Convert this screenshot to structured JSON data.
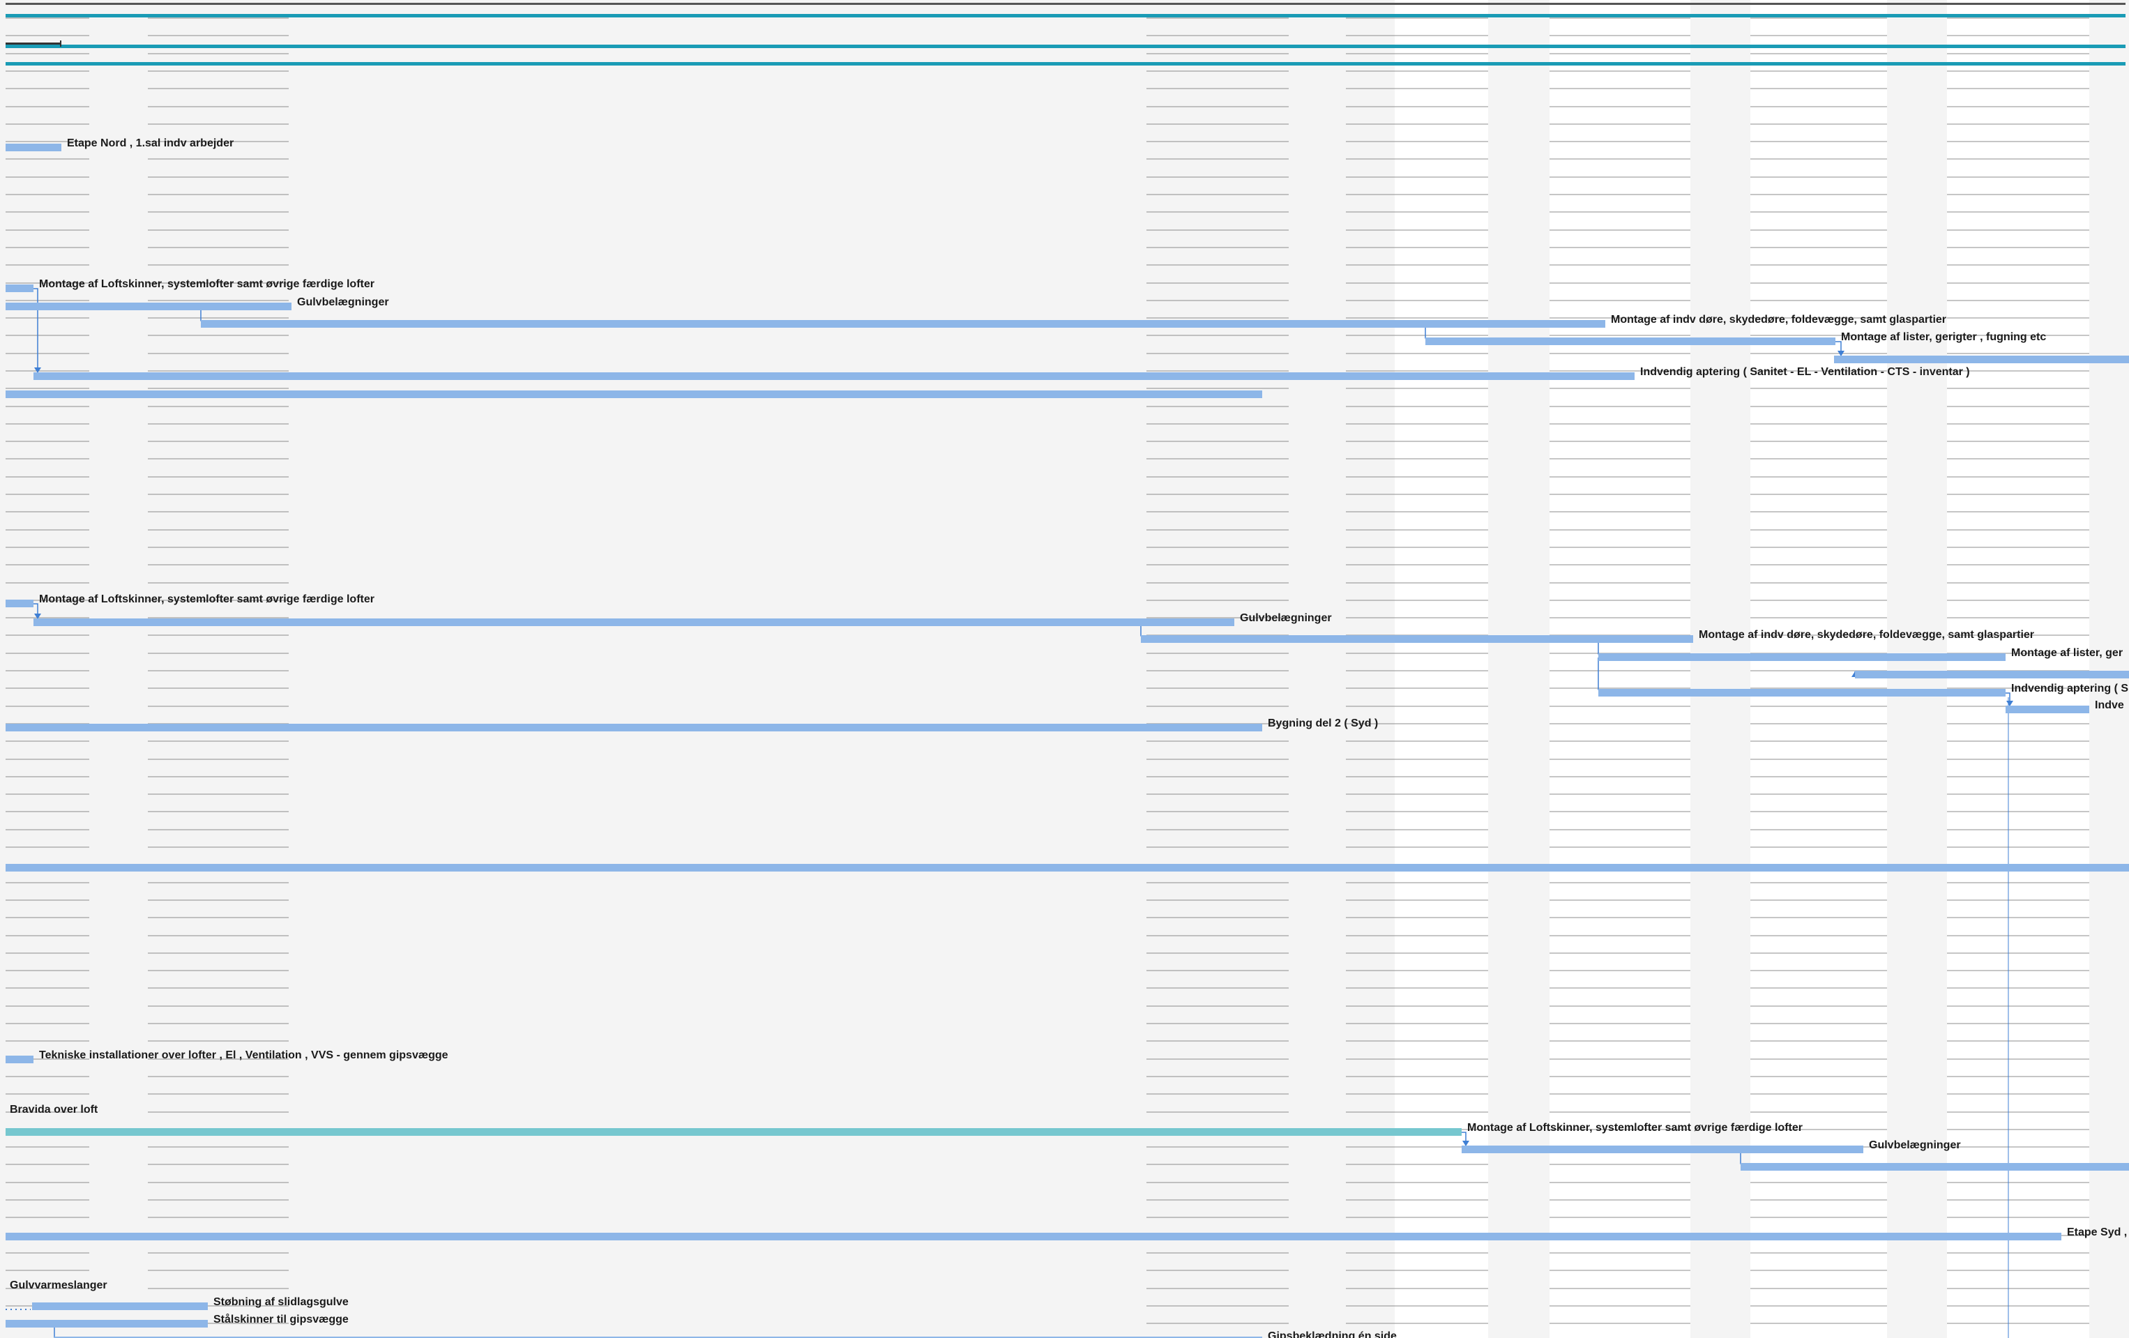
{
  "view": "gantt-chart",
  "colors": {
    "task_bar": "#8DB6E8",
    "critical_bar": "#76C7CF",
    "summary_line": "#1A9BB5",
    "link": "#3F7FD4",
    "gridline": "#8C8C8C",
    "nonworking_shade": "#F4F4F4"
  },
  "tasks": [
    {
      "label": "Etape Nord , 1.sal indv arbejder"
    },
    {
      "label": "Montage af Loftskinner, systemlofter samt øvrige færdige lofter"
    },
    {
      "label": "Gulvbelægninger"
    },
    {
      "label": "Montage af indv døre, skydedøre, foldevægge, samt glaspartier"
    },
    {
      "label": "Montage af lister, gerigter , fugning etc"
    },
    {
      "label": "Indvendig aptering ( Sanitet - EL - Ventilation - CTS - inventar )"
    },
    {
      "label": "Montage af Loftskinner, systemlofter samt øvrige færdige lofter"
    },
    {
      "label": "Gulvbelægninger"
    },
    {
      "label": "Montage af indv døre, skydedøre, foldevægge, samt glaspartier"
    },
    {
      "label": "Montage af lister, ger"
    },
    {
      "label": "Indvendig aptering ( S"
    },
    {
      "label": "Indve"
    },
    {
      "label": "Bygning del 2 ( Syd )"
    },
    {
      "label": "Tekniske installationer over lofter , El , Ventilation , VVS - gennem gipsvægge"
    },
    {
      "label": "Bravida over loft"
    },
    {
      "label": "Montage af Loftskinner, systemlofter samt øvrige færdige lofter"
    },
    {
      "label": "Gulvbelægninger"
    },
    {
      "label": "Etape Syd ,"
    },
    {
      "label": "Gulvvarmeslanger"
    },
    {
      "label": "Støbning af slidlagsgulve"
    },
    {
      "label": "Stålskinner til gipsvægge"
    },
    {
      "label": "Gipsbeklædning én side"
    }
  ]
}
